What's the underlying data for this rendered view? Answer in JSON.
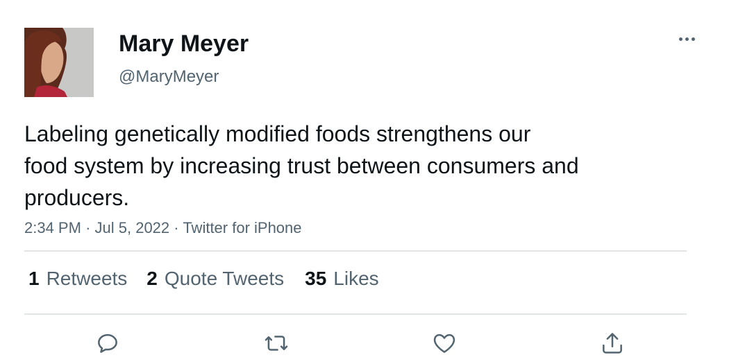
{
  "author": {
    "display_name": "Mary Meyer",
    "handle": "@MaryMeyer"
  },
  "tweet": {
    "text_lines": [
      "Labeling genetically modified foods strengthens our",
      "food system by increasing trust between consumers and",
      "producers."
    ],
    "time": "2:34 PM",
    "date": "Jul 5, 2022",
    "source": "Twitter for iPhone",
    "separator": "·"
  },
  "stats": {
    "retweets": {
      "count": "1",
      "label": "Retweets"
    },
    "quote_tweets": {
      "count": "2",
      "label": "Quote Tweets"
    },
    "likes": {
      "count": "35",
      "label": "Likes"
    }
  },
  "actions": [
    "reply-icon",
    "retweet-icon",
    "like-icon",
    "share-icon"
  ],
  "colors": {
    "text": "#0f1419",
    "secondary": "#536471",
    "divider": "#e1e5e8"
  }
}
